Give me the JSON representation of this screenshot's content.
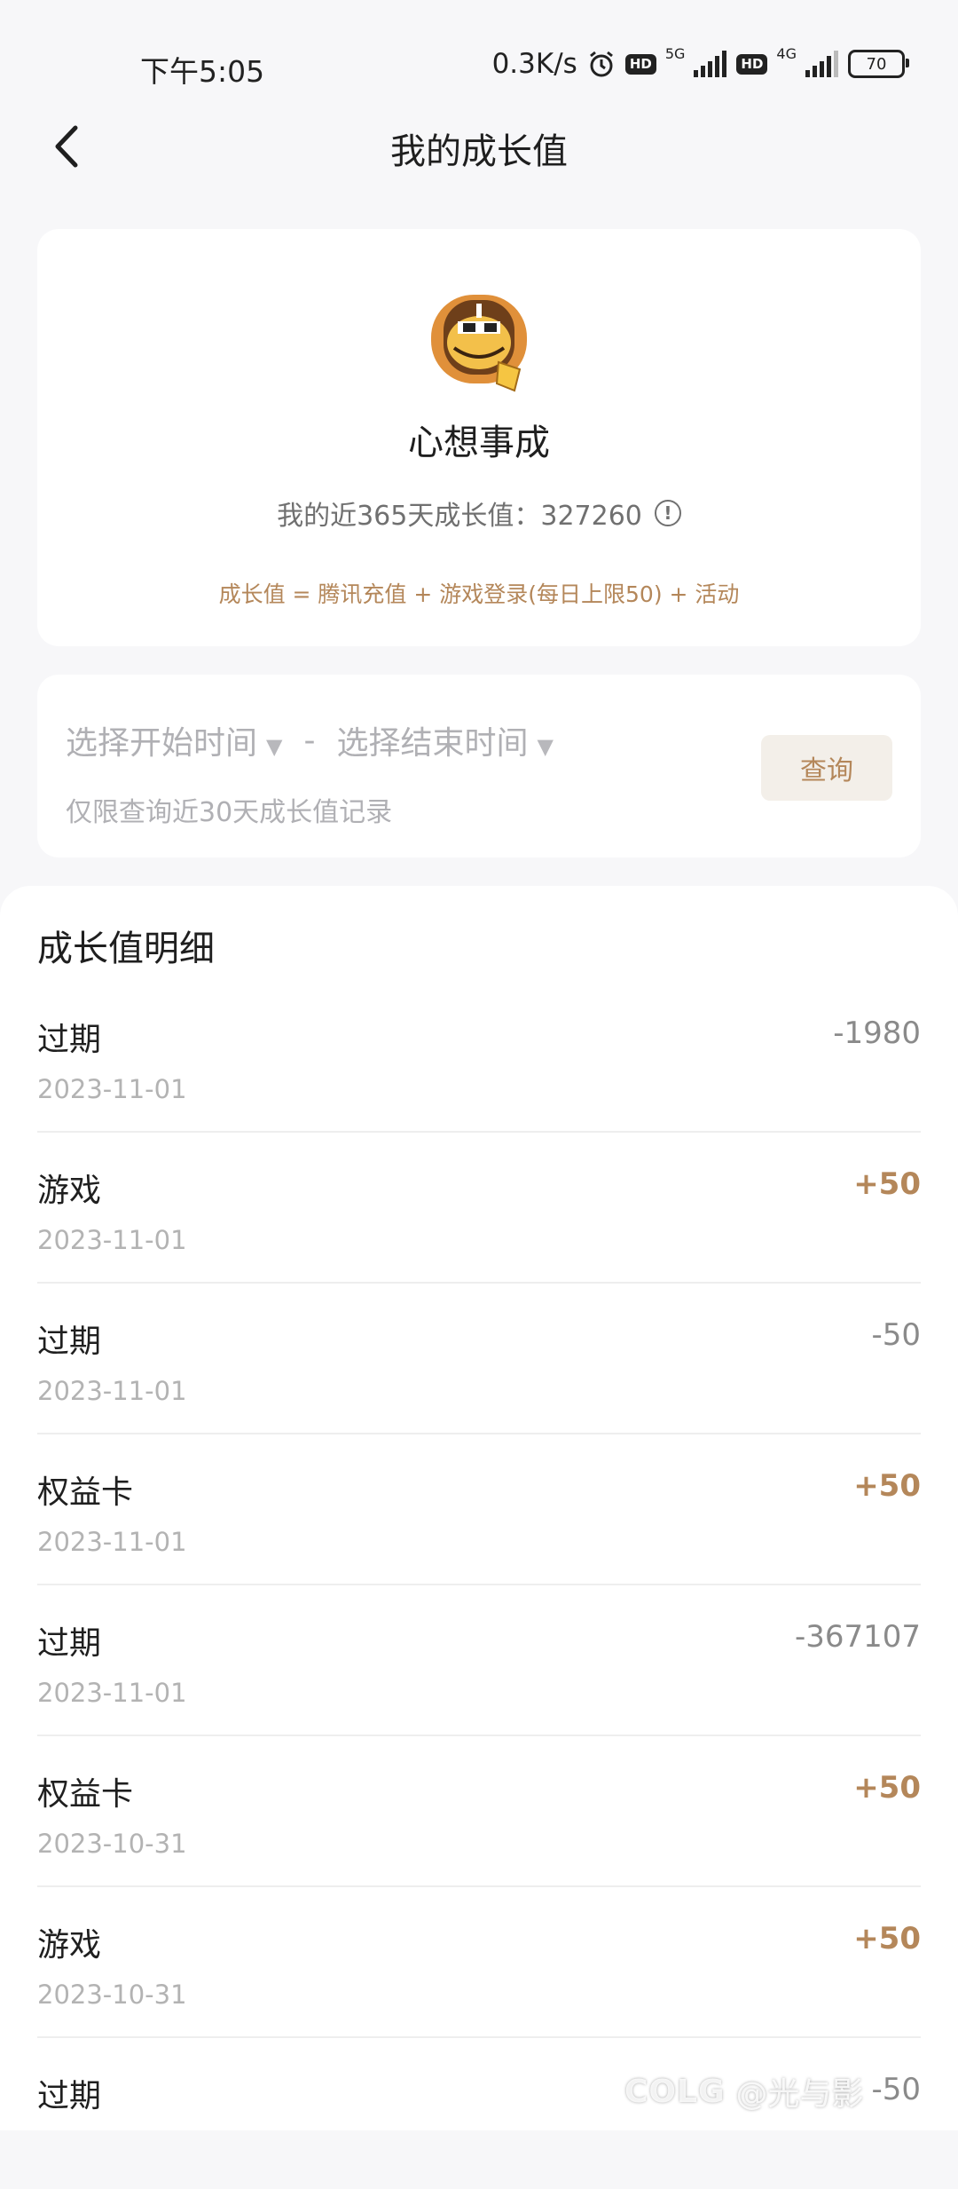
{
  "status_bar": {
    "time": "下午5:05",
    "net_speed": "0.3K/s",
    "sim1_network": "5G",
    "sim2_network": "4G",
    "hd_label": "HD",
    "battery": "70"
  },
  "nav": {
    "title": "我的成长值"
  },
  "profile": {
    "level_name": "心想事成",
    "growth_label": "我的近365天成长值：327260",
    "formula": "成长值 = 腾讯充值 + 游戏登录(每日上限50) + 活动"
  },
  "query": {
    "start_placeholder": "选择开始时间",
    "separator": "-",
    "end_placeholder": "选择结束时间",
    "hint": "仅限查询近30天成长值记录",
    "button_label": "查询"
  },
  "detail": {
    "title": "成长值明细",
    "records": [
      {
        "type": "过期",
        "date": "2023-11-01",
        "amount": "-1980"
      },
      {
        "type": "游戏",
        "date": "2023-11-01",
        "amount": "+50"
      },
      {
        "type": "过期",
        "date": "2023-11-01",
        "amount": "-50"
      },
      {
        "type": "权益卡",
        "date": "2023-11-01",
        "amount": "+50"
      },
      {
        "type": "过期",
        "date": "2023-11-01",
        "amount": "-367107"
      },
      {
        "type": "权益卡",
        "date": "2023-10-31",
        "amount": "+50"
      },
      {
        "type": "游戏",
        "date": "2023-10-31",
        "amount": "+50"
      },
      {
        "type": "过期",
        "date": "",
        "amount": "-50"
      }
    ]
  },
  "watermark": {
    "logo": "COLG",
    "handle": "@光与影"
  },
  "colors": {
    "accent_gold": "#b4875a",
    "negative_gray": "#8a8a8a",
    "background": "#f7f7f9"
  }
}
